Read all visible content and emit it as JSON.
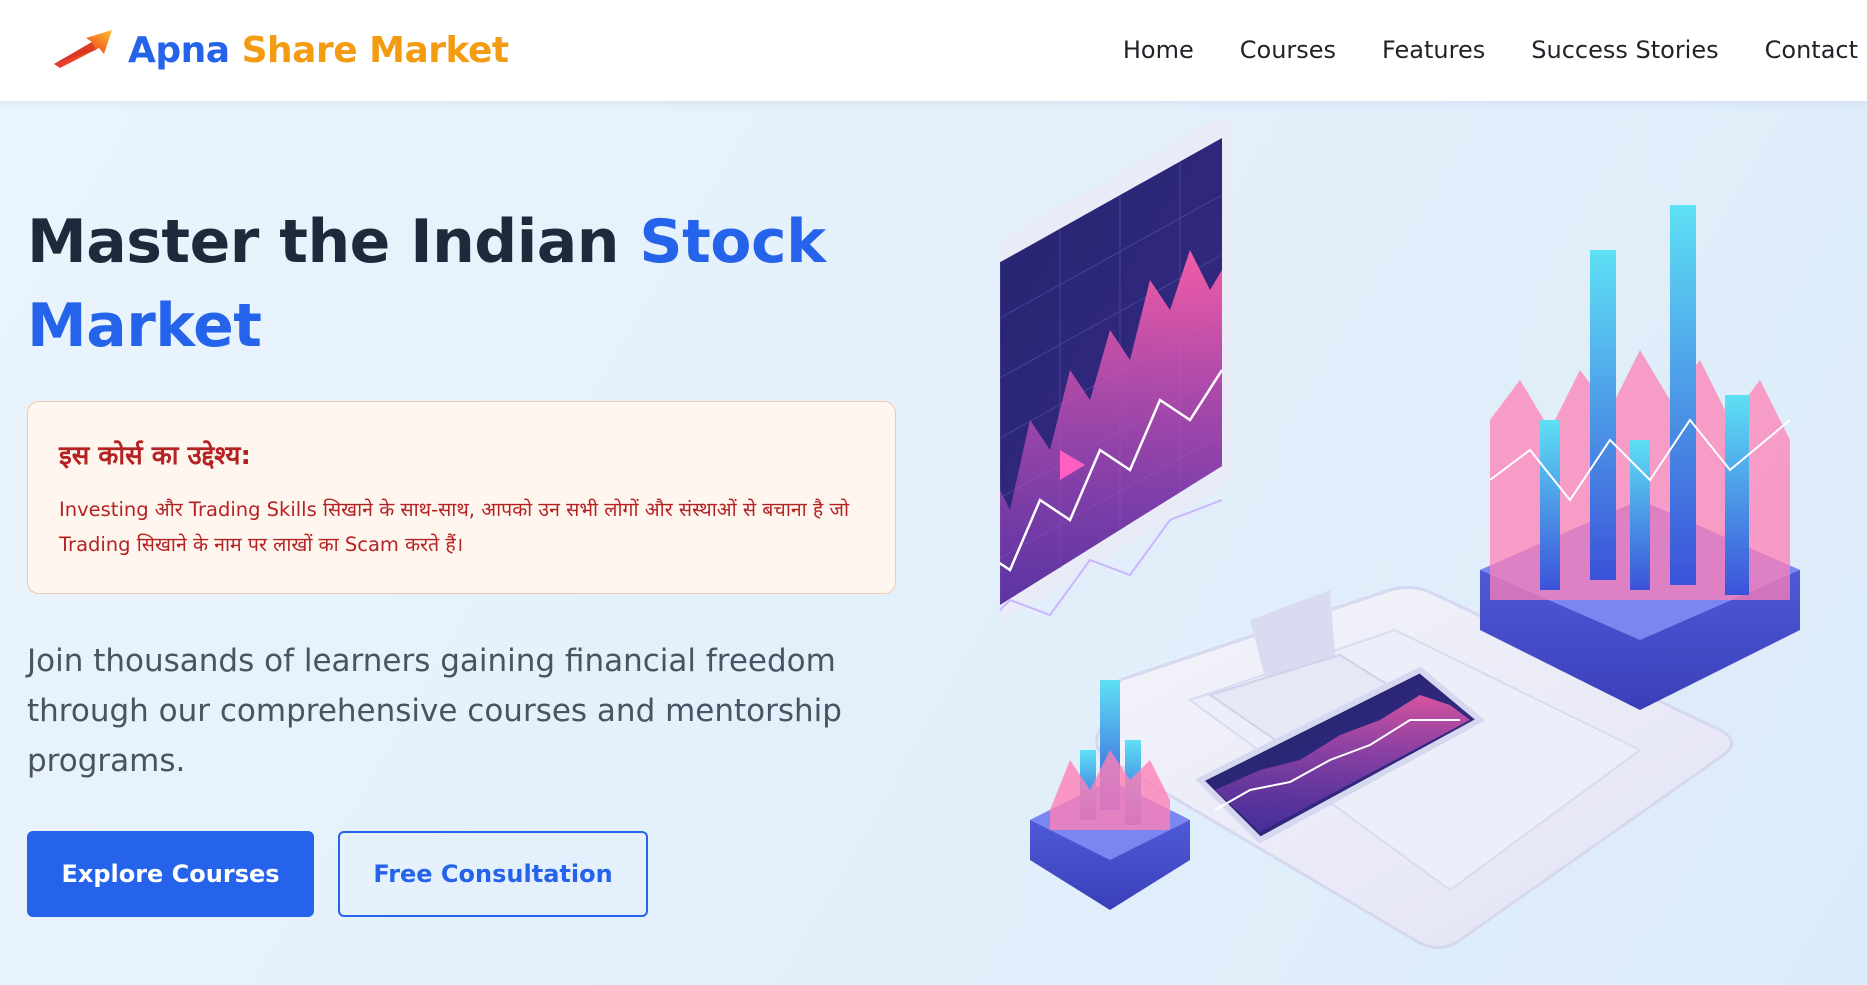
{
  "header": {
    "brand": {
      "part1": "Apna",
      "part2": "Share Market",
      "logo_icon": "rising-arrow-logo"
    },
    "nav": [
      {
        "label": "Home"
      },
      {
        "label": "Courses"
      },
      {
        "label": "Features"
      },
      {
        "label": "Success Stories"
      },
      {
        "label": "Contact"
      }
    ]
  },
  "hero": {
    "title_part1": "Master the Indian",
    "title_accent": "Stock Market",
    "objective": {
      "heading": "इस कोर्स का उद्देश्य:",
      "text": "Investing और Trading Skills सिखाने के साथ-साथ, आपको उन सभी लोगों और संस्थाओं से बचाना है जो Trading सिखाने के नाम पर लाखों का Scam करते हैं।"
    },
    "description": "Join thousands of learners gaining financial freedom through our comprehensive courses and mentorship programs.",
    "buttons": {
      "primary": "Explore Courses",
      "secondary": "Free Consultation"
    },
    "illustration_icon": "stock-market-dashboard-illustration"
  },
  "colors": {
    "brand_blue": "#2563eb",
    "brand_orange": "#f39c12",
    "objective_red": "#b42323",
    "objective_bg": "#fff6ef"
  }
}
